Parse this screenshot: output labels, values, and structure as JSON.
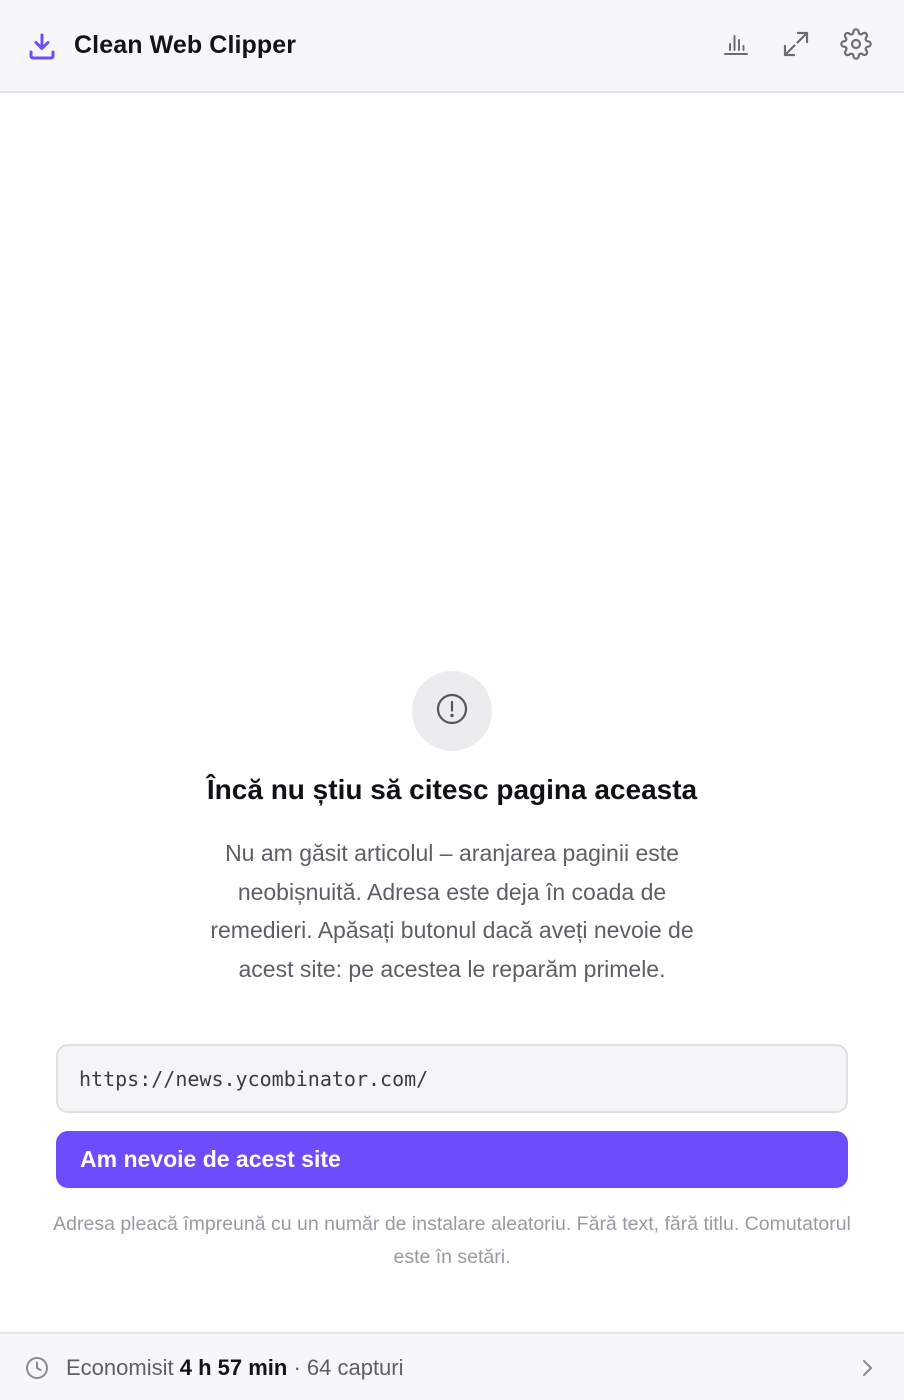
{
  "header": {
    "title": "Clean Web Clipper",
    "icons": {
      "brand": "download-icon",
      "stats": "bar-chart-icon",
      "expand": "expand-icon",
      "settings": "gear-icon"
    }
  },
  "message": {
    "icon": "alert-circle-icon",
    "title": "Încă nu știu să citesc pagina aceasta",
    "description": "Nu am găsit articolul – aranjarea paginii este neobișnuită. Adresa este deja în coada de remedieri. Apăsați butonul dacă aveți nevoie de acest site: pe acestea le reparăm primele."
  },
  "url_field": {
    "value": "https://news.ycombinator.com/"
  },
  "cta": {
    "label": "Am nevoie de acest site"
  },
  "privacy_note": "Adresa pleacă împreună cu un număr de instalare aleatoriu. Fără text, fără titlu. Comutatorul este în setări.",
  "footer": {
    "prefix": "Economisit",
    "time_saved": "4 h 57 min",
    "separator": "·",
    "captures": "64 capturi",
    "icons": {
      "left": "clock-icon",
      "right": "chevron-right-icon"
    }
  },
  "colors": {
    "accent": "#6d4cfc",
    "header_bg": "#f7f7f9",
    "text_muted": "#5e5e68"
  }
}
